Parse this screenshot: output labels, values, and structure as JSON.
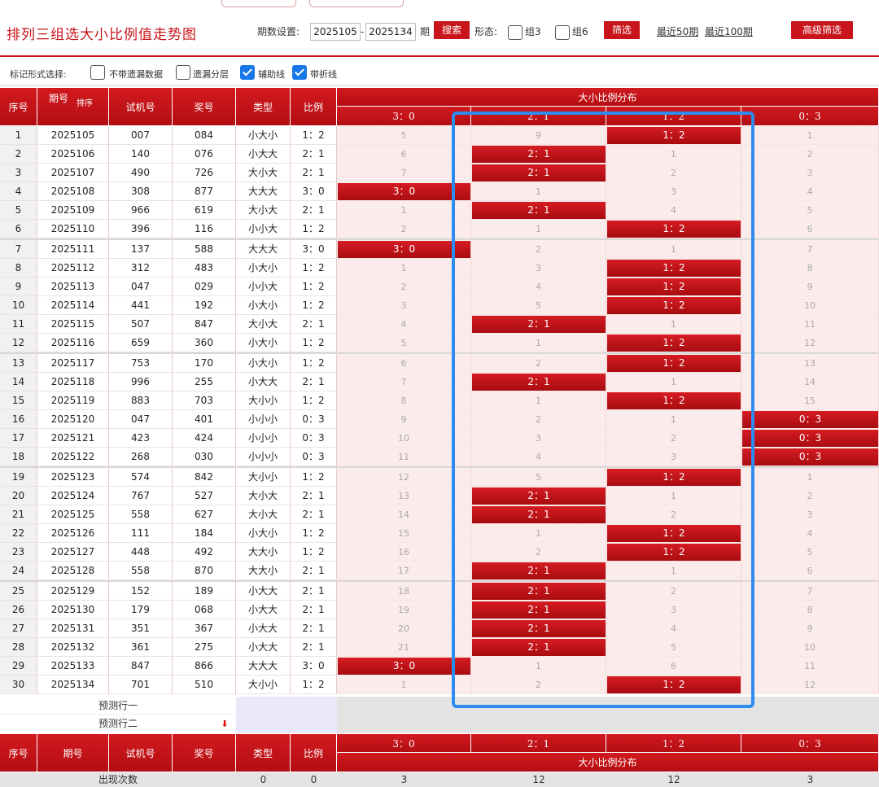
{
  "header": {
    "title": "排列三组选大小比例值走势图",
    "period_label": "期数设置:",
    "period_from": "2025105",
    "period_dash": "-",
    "period_to": "2025134",
    "period_unit": "期",
    "search_button": "搜索",
    "form_label": "形态:",
    "group3_label": "组3",
    "group6_label": "组6",
    "filter_button": "筛选",
    "recent50": "最近50期",
    "recent100": "最近100期",
    "advanced_filter": "高级筛选"
  },
  "markbar": {
    "label": "标记形式选择:",
    "options": [
      {
        "label": "不带遗漏数据",
        "checked": false
      },
      {
        "label": "遗漏分层",
        "checked": false
      },
      {
        "label": "辅助线",
        "checked": true
      },
      {
        "label": "带折线",
        "checked": true
      }
    ]
  },
  "table": {
    "columns": {
      "seq": "序号",
      "issue": "期号",
      "sort": "排序",
      "test": "试机号",
      "prize": "奖号",
      "type": "类型",
      "ratio": "比例"
    },
    "dist_title": "大小比例分布",
    "ratio_headers": [
      "3：0",
      "2：1",
      "1：2",
      "0：3"
    ],
    "rows": [
      {
        "seq": "1",
        "issue": "2025105",
        "test": "007",
        "prize": "084",
        "type": "小大小",
        "ratio": "1：2",
        "cols": [
          "5",
          "9",
          null,
          "1"
        ]
      },
      {
        "seq": "2",
        "issue": "2025106",
        "test": "140",
        "prize": "076",
        "type": "小大大",
        "ratio": "2：1",
        "cols": [
          "6",
          null,
          "1",
          "2"
        ]
      },
      {
        "seq": "3",
        "issue": "2025107",
        "test": "490",
        "prize": "726",
        "type": "大小大",
        "ratio": "2：1",
        "cols": [
          "7",
          null,
          "2",
          "3"
        ]
      },
      {
        "seq": "4",
        "issue": "2025108",
        "test": "308",
        "prize": "877",
        "type": "大大大",
        "ratio": "3：0",
        "cols": [
          null,
          "1",
          "3",
          "4"
        ]
      },
      {
        "seq": "5",
        "issue": "2025109",
        "test": "966",
        "prize": "619",
        "type": "大小大",
        "ratio": "2：1",
        "cols": [
          "1",
          null,
          "4",
          "5"
        ]
      },
      {
        "seq": "6",
        "issue": "2025110",
        "test": "396",
        "prize": "116",
        "type": "小小大",
        "ratio": "1：2",
        "cols": [
          "2",
          "1",
          null,
          "6"
        ]
      },
      {
        "seq": "7",
        "issue": "2025111",
        "test": "137",
        "prize": "588",
        "type": "大大大",
        "ratio": "3：0",
        "cols": [
          null,
          "2",
          "1",
          "7"
        ]
      },
      {
        "seq": "8",
        "issue": "2025112",
        "test": "312",
        "prize": "483",
        "type": "小大小",
        "ratio": "1：2",
        "cols": [
          "1",
          "3",
          null,
          "8"
        ]
      },
      {
        "seq": "9",
        "issue": "2025113",
        "test": "047",
        "prize": "029",
        "type": "小小大",
        "ratio": "1：2",
        "cols": [
          "2",
          "4",
          null,
          "9"
        ]
      },
      {
        "seq": "10",
        "issue": "2025114",
        "test": "441",
        "prize": "192",
        "type": "小大小",
        "ratio": "1：2",
        "cols": [
          "3",
          "5",
          null,
          "10"
        ]
      },
      {
        "seq": "11",
        "issue": "2025115",
        "test": "507",
        "prize": "847",
        "type": "大小大",
        "ratio": "2：1",
        "cols": [
          "4",
          null,
          "1",
          "11"
        ]
      },
      {
        "seq": "12",
        "issue": "2025116",
        "test": "659",
        "prize": "360",
        "type": "小大小",
        "ratio": "1：2",
        "cols": [
          "5",
          "1",
          null,
          "12"
        ]
      },
      {
        "seq": "13",
        "issue": "2025117",
        "test": "753",
        "prize": "170",
        "type": "小大小",
        "ratio": "1：2",
        "cols": [
          "6",
          "2",
          null,
          "13"
        ]
      },
      {
        "seq": "14",
        "issue": "2025118",
        "test": "996",
        "prize": "255",
        "type": "小大大",
        "ratio": "2：1",
        "cols": [
          "7",
          null,
          "1",
          "14"
        ]
      },
      {
        "seq": "15",
        "issue": "2025119",
        "test": "883",
        "prize": "703",
        "type": "大小小",
        "ratio": "1：2",
        "cols": [
          "8",
          "1",
          null,
          "15"
        ]
      },
      {
        "seq": "16",
        "issue": "2025120",
        "test": "047",
        "prize": "401",
        "type": "小小小",
        "ratio": "0：3",
        "cols": [
          "9",
          "2",
          "1",
          null
        ]
      },
      {
        "seq": "17",
        "issue": "2025121",
        "test": "423",
        "prize": "424",
        "type": "小小小",
        "ratio": "0：3",
        "cols": [
          "10",
          "3",
          "2",
          null
        ]
      },
      {
        "seq": "18",
        "issue": "2025122",
        "test": "268",
        "prize": "030",
        "type": "小小小",
        "ratio": "0：3",
        "cols": [
          "11",
          "4",
          "3",
          null
        ]
      },
      {
        "seq": "19",
        "issue": "2025123",
        "test": "574",
        "prize": "842",
        "type": "大小小",
        "ratio": "1：2",
        "cols": [
          "12",
          "5",
          null,
          "1"
        ]
      },
      {
        "seq": "20",
        "issue": "2025124",
        "test": "767",
        "prize": "527",
        "type": "大小大",
        "ratio": "2：1",
        "cols": [
          "13",
          null,
          "1",
          "2"
        ]
      },
      {
        "seq": "21",
        "issue": "2025125",
        "test": "558",
        "prize": "627",
        "type": "大小大",
        "ratio": "2：1",
        "cols": [
          "14",
          null,
          "2",
          "3"
        ]
      },
      {
        "seq": "22",
        "issue": "2025126",
        "test": "111",
        "prize": "184",
        "type": "小大小",
        "ratio": "1：2",
        "cols": [
          "15",
          "1",
          null,
          "4"
        ]
      },
      {
        "seq": "23",
        "issue": "2025127",
        "test": "448",
        "prize": "492",
        "type": "大大小",
        "ratio": "1：2",
        "cols": [
          "16",
          "2",
          null,
          "5"
        ]
      },
      {
        "seq": "24",
        "issue": "2025128",
        "test": "558",
        "prize": "870",
        "type": "大大小",
        "ratio": "2：1",
        "cols": [
          "17",
          null,
          "1",
          "6"
        ]
      },
      {
        "seq": "25",
        "issue": "2025129",
        "test": "152",
        "prize": "189",
        "type": "小大大",
        "ratio": "2：1",
        "cols": [
          "18",
          null,
          "2",
          "7"
        ]
      },
      {
        "seq": "26",
        "issue": "2025130",
        "test": "179",
        "prize": "068",
        "type": "小大大",
        "ratio": "2：1",
        "cols": [
          "19",
          null,
          "3",
          "8"
        ]
      },
      {
        "seq": "27",
        "issue": "2025131",
        "test": "351",
        "prize": "367",
        "type": "小大大",
        "ratio": "2：1",
        "cols": [
          "20",
          null,
          "4",
          "9"
        ]
      },
      {
        "seq": "28",
        "issue": "2025132",
        "test": "361",
        "prize": "275",
        "type": "小大大",
        "ratio": "2：1",
        "cols": [
          "21",
          null,
          "5",
          "10"
        ]
      },
      {
        "seq": "29",
        "issue": "2025133",
        "test": "847",
        "prize": "866",
        "type": "大大大",
        "ratio": "3：0",
        "cols": [
          null,
          "1",
          "6",
          "11"
        ]
      },
      {
        "seq": "30",
        "issue": "2025134",
        "test": "701",
        "prize": "510",
        "type": "大小小",
        "ratio": "1：2",
        "cols": [
          "1",
          "2",
          null,
          "12"
        ]
      }
    ],
    "predict1": "预测行一",
    "predict2": "预测行二",
    "footer": {
      "seq": "序号",
      "issue": "期号",
      "test": "试机号",
      "prize": "奖号",
      "type": "类型",
      "ratio": "比例",
      "dist_title": "大小比例分布",
      "count_label": "出现次数",
      "counts": [
        "0",
        "0",
        "3",
        "12",
        "12",
        "3"
      ]
    }
  },
  "colors": {
    "brand_red": "#c9141b",
    "highlight_blue": "#2d8cf0"
  }
}
